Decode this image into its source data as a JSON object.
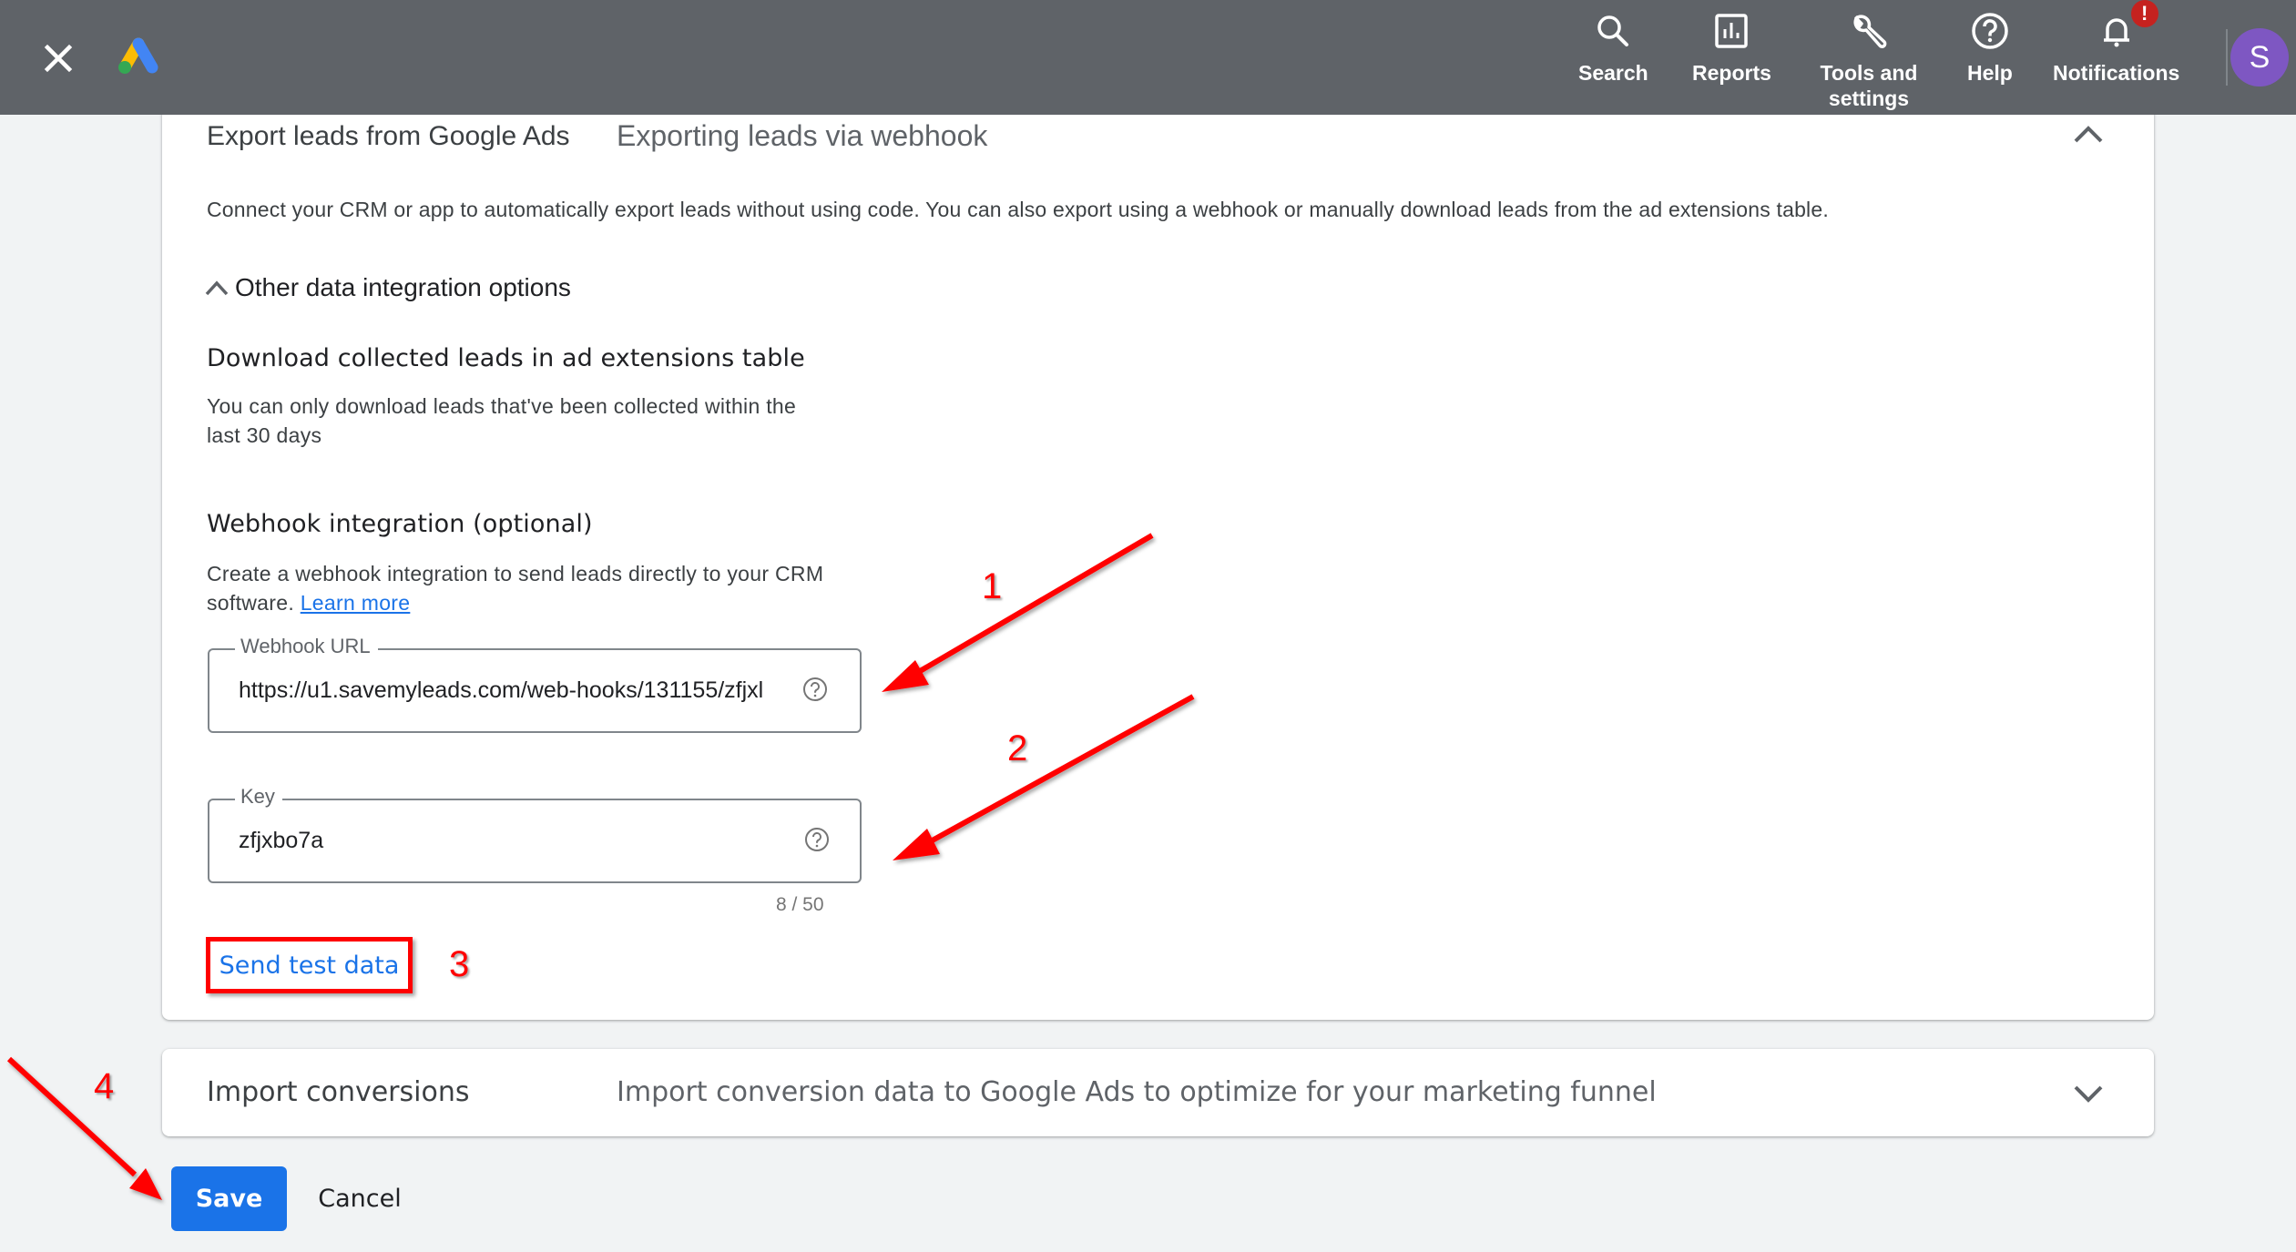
{
  "header": {
    "close_icon": "close-icon",
    "logo": "google-ads-logo",
    "nav": [
      {
        "label": "Search",
        "icon": "search-icon"
      },
      {
        "label": "Reports",
        "icon": "reports-icon"
      },
      {
        "label": "Tools and settings",
        "icon": "wrench-icon"
      },
      {
        "label": "Help",
        "icon": "help-icon"
      },
      {
        "label": "Notifications",
        "icon": "bell-icon",
        "badge": "!"
      }
    ],
    "avatar_initial": "S",
    "colors": {
      "bar": "#5f6368",
      "avatar": "#7e57c2",
      "badge": "#c5221f"
    }
  },
  "export_section": {
    "title": "Export leads from Google Ads",
    "subtitle": "Exporting leads via webhook",
    "description": "Connect your CRM or app to automatically export leads without using code. You can also export using a webhook or manually download leads from the ad extensions table.",
    "other_options_toggle": "Other data integration options",
    "download": {
      "heading": "Download collected leads in ad extensions table",
      "text_line1": "You can only download leads that've been collected within the",
      "text_line2": "last 30 days"
    },
    "webhook": {
      "heading": "Webhook integration (optional)",
      "text_line1": "Create a webhook integration to send leads directly to your CRM",
      "text_line2_prefix": "software.",
      "learn_more": "Learn more",
      "url_field": {
        "label": "Webhook URL",
        "value": "https://u1.savemyleads.com/web-hooks/131155/zfjxl"
      },
      "key_field": {
        "label": "Key",
        "value": "zfjxbo7a",
        "counter": "8 / 50"
      },
      "send_test_label": "Send test data"
    }
  },
  "import_section": {
    "title": "Import conversions",
    "subtitle": "Import conversion data to Google Ads to optimize for your marketing funnel"
  },
  "actions": {
    "save_label": "Save",
    "cancel_label": "Cancel",
    "primary_color": "#1a73e8"
  },
  "annotations": {
    "step1": "1",
    "step2": "2",
    "step3": "3",
    "step4": "4",
    "color": "#ff0000"
  }
}
